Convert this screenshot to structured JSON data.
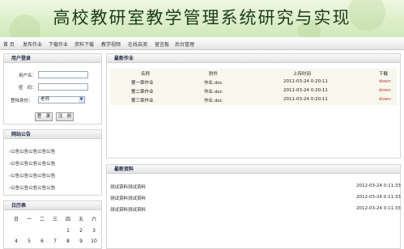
{
  "banner": {
    "title": "高校教研室教学管理系统研究与实现"
  },
  "nav": {
    "items": [
      "首 页",
      "发布作业",
      "下载作业",
      "资料下载",
      "教学视频",
      "在线自测",
      "留言板",
      "后台管理"
    ]
  },
  "login": {
    "title": "用户登录",
    "username_label": "用户名：",
    "password_label": "密　码：",
    "identity_label": "登陆身份：",
    "identity_value": "老师",
    "login_button": "登　录",
    "register_button": "注　册"
  },
  "notices": {
    "title": "网站公告",
    "items": [
      "公告公告公告公告公告",
      "公告公告公告公告公告",
      "公告公告公告公告公告",
      "公告公告公告公告公告"
    ]
  },
  "calendar": {
    "title": "日历表",
    "weekdays": [
      "日",
      "一",
      "二",
      "三",
      "四",
      "五",
      "六"
    ],
    "row1": [
      "",
      "",
      "",
      "",
      "1",
      "2",
      "3"
    ],
    "row2": [
      "4",
      "5",
      "6",
      "7",
      "8",
      "9",
      "10"
    ]
  },
  "homework": {
    "title": "最新作业",
    "headers": [
      "名称",
      "附件",
      "上传时间",
      "下载"
    ],
    "rows": [
      {
        "name": "第一章作业",
        "file": "作业.doc",
        "time": "2011-03-24 0:20:11",
        "action": "down"
      },
      {
        "name": "第二章作业",
        "file": "作业.doc",
        "time": "2011-03-24 0:20:11",
        "action": "down"
      },
      {
        "name": "第三章作业",
        "file": "作业.doc",
        "time": "2011-03-24 0:20:11",
        "action": "down"
      }
    ]
  },
  "resources": {
    "title": "最新资料",
    "rows": [
      {
        "name": "测试资料测试资料",
        "time": "2012-03-24 0:11:33"
      },
      {
        "name": "测试资料测试资料",
        "time": "2012-03-24 0:11:33"
      },
      {
        "name": "测试资料测试资料",
        "time": "2012-03-24 0:11:33"
      }
    ]
  },
  "colors": {
    "banner": "#dceec8",
    "panel_header": "#e3e3e3",
    "link_red": "#c0392b"
  }
}
